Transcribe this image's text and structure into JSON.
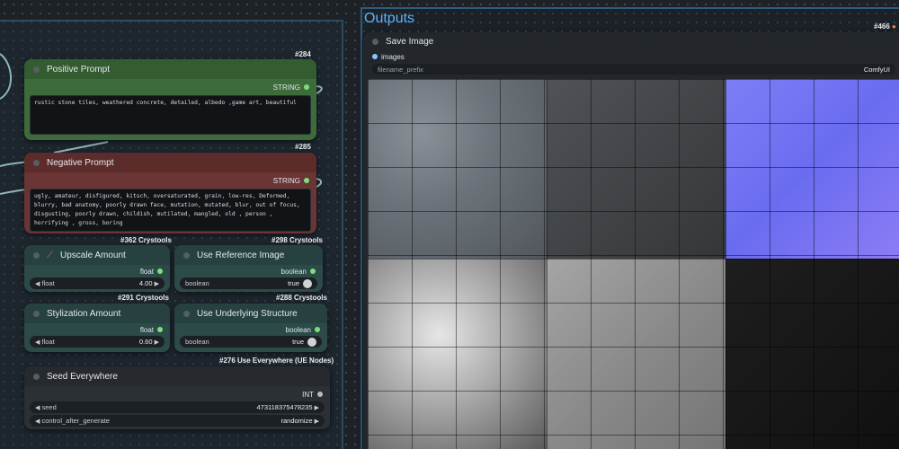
{
  "groups": {
    "outputs_title": "Outputs"
  },
  "positive_prompt": {
    "badge": "#284",
    "title": "Positive Prompt",
    "output_label": "STRING",
    "text": "rustic stone tiles, weathered concrete, detailed, albedo ,game art, beautiful",
    "footer_badge": "#285"
  },
  "negative_prompt": {
    "title": "Negative Prompt",
    "output_label": "STRING",
    "text": "ugly, amateur, disfigured, kitsch, oversaturated, grain, low-res, Deformed, blurry, bad anatomy, poorly drawn face, mutation, mutated, blur, out of focus, disgusting, poorly drawn, childish, mutilated, mangled, old , person , horrifying , gross, boring",
    "footer_badge_left": "#362 Crystools",
    "footer_badge_right": "#298 Crystools"
  },
  "upscale_amount": {
    "title": "Upscale Amount",
    "output_label": "float",
    "widget_label": "float",
    "widget_value": "4.00",
    "footer_badge": "#291 Crystools"
  },
  "use_reference_image": {
    "title": "Use Reference Image",
    "output_label": "boolean",
    "widget_label": "boolean",
    "widget_value": "true",
    "footer_badge": "#288 Crystools"
  },
  "stylization_amount": {
    "title": "Stylization Amount",
    "output_label": "float",
    "widget_label": "float",
    "widget_value": "0.60"
  },
  "use_underlying_structure": {
    "title": "Use Underlying Structure",
    "output_label": "boolean",
    "widget_label": "boolean",
    "widget_value": "true",
    "footer_badge": "#276 Use Everywhere (UE Nodes)"
  },
  "seed_everywhere": {
    "title": "Seed Everywhere",
    "output_label": "INT",
    "seed_label": "seed",
    "seed_value": "473118375478235",
    "control_label": "control_after_generate",
    "control_value": "randomize"
  },
  "save_image": {
    "badge": "#466",
    "title": "Save Image",
    "input_label": "images",
    "prefix_label": "filename_prefix",
    "prefix_value": "ComfyUI"
  },
  "colors": {
    "positive_node": "#3d6b3a",
    "negative_node": "#6a3534",
    "primitive_node": "#2c4a48",
    "seed_node": "#2b3035",
    "link": "#8fb7b8"
  },
  "icons": {
    "upscale": "wand-icon",
    "save_image_badge": "fox-icon"
  }
}
